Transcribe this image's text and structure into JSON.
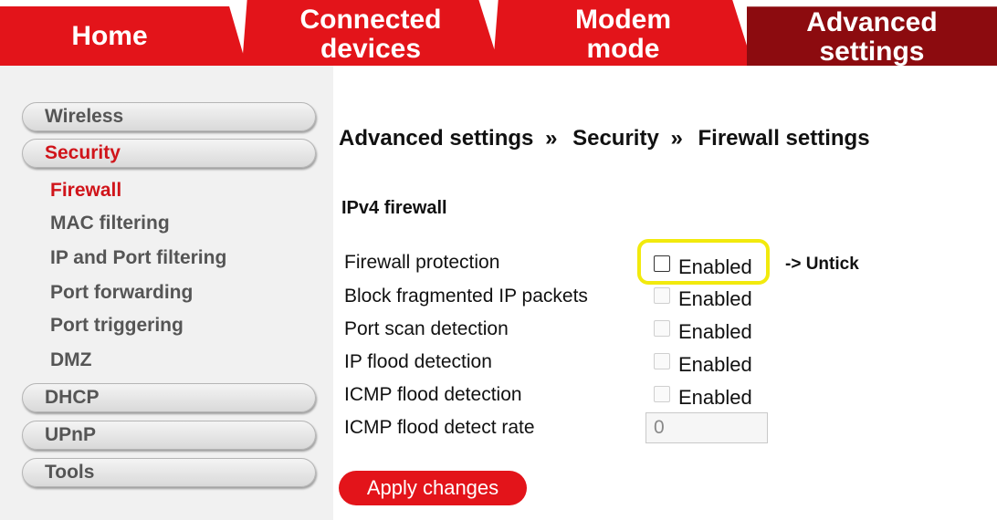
{
  "tabs": {
    "home": [
      "Home"
    ],
    "connected": [
      "Connected",
      "devices"
    ],
    "modem": [
      "Modem",
      "mode"
    ],
    "advanced": [
      "Advanced",
      "settings"
    ]
  },
  "sidebar": {
    "wireless": "Wireless",
    "security": "Security",
    "sub": {
      "firewall": "Firewall",
      "mac": "MAC filtering",
      "ipport": "IP and Port filtering",
      "portfwd": "Port forwarding",
      "porttrig": "Port triggering",
      "dmz": "DMZ"
    },
    "dhcp": "DHCP",
    "upnp": "UPnP",
    "tools": "Tools"
  },
  "breadcrumb": [
    "Advanced settings",
    "»",
    "Security",
    "»",
    "Firewall settings"
  ],
  "section_title": "IPv4 firewall",
  "rows": {
    "firewall_protection": {
      "label": "Firewall protection",
      "option": "Enabled",
      "checked": false
    },
    "block_fragmented": {
      "label": "Block fragmented IP packets",
      "option": "Enabled",
      "checked": false
    },
    "port_scan": {
      "label": "Port scan detection",
      "option": "Enabled",
      "checked": false
    },
    "ip_flood": {
      "label": "IP flood detection",
      "option": "Enabled",
      "checked": false
    },
    "icmp_flood": {
      "label": "ICMP flood detection",
      "option": "Enabled",
      "checked": false
    },
    "icmp_rate": {
      "label": "ICMP flood detect rate",
      "value": "0"
    }
  },
  "annotation": "-> Untick",
  "apply_label": "Apply changes",
  "colors": {
    "brand_red": "#e3141a",
    "active_tab": "#8c0b0f",
    "highlight_yellow": "#f2ea0d"
  }
}
